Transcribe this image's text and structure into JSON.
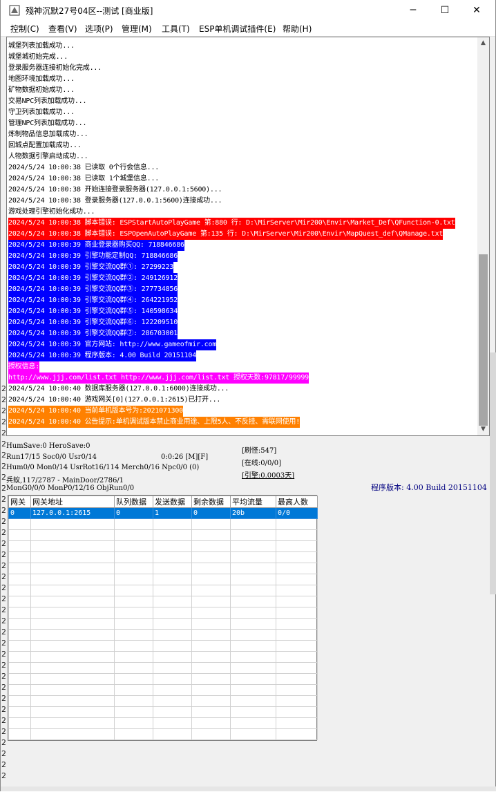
{
  "window": {
    "title": "殘神沉默27号04区--测试 [商业版]",
    "minimize_glyph": "─",
    "maximize_glyph": "☐",
    "close_glyph": "✕"
  },
  "menu": [
    "控制(C)",
    "查看(V)",
    "选项(P)",
    "管理(M)",
    "工具(T)",
    "ESP单机调试插件(E)",
    "帮助(H)"
  ],
  "log": [
    {
      "text": "城堡列表加载成功...",
      "bg": "",
      "fg": "#000000"
    },
    {
      "text": "城堡城初始完成...",
      "bg": "",
      "fg": "#000000"
    },
    {
      "text": "登录服务器连接初始化完成...",
      "bg": "",
      "fg": "#000000"
    },
    {
      "text": "地图环境加载成功...",
      "bg": "",
      "fg": "#000000"
    },
    {
      "text": "矿物数据初始成功...",
      "bg": "",
      "fg": "#000000"
    },
    {
      "text": "交易NPC列表加载成功...",
      "bg": "",
      "fg": "#000000"
    },
    {
      "text": "守卫列表加载成功...",
      "bg": "",
      "fg": "#000000"
    },
    {
      "text": "管理NPC列表加载成功...",
      "bg": "",
      "fg": "#000000"
    },
    {
      "text": "炼制物品信息加载成功...",
      "bg": "",
      "fg": "#000000"
    },
    {
      "text": "回城点配置加载成功...",
      "bg": "",
      "fg": "#000000"
    },
    {
      "text": "人物数据引擎启动成功...",
      "bg": "",
      "fg": "#000000"
    },
    {
      "text": "2024/5/24 10:00:38 已读取 0个行会信息...",
      "bg": "",
      "fg": "#000000"
    },
    {
      "text": "2024/5/24 10:00:38 已读取 1个城堡信息...",
      "bg": "",
      "fg": "#000000"
    },
    {
      "text": "2024/5/24 10:00:38 开始连接登录服务器(127.0.0.1:5600)...",
      "bg": "",
      "fg": "#000000"
    },
    {
      "text": "2024/5/24 10:00:38 登录服务器(127.0.0.1:5600)连接成功...",
      "bg": "",
      "fg": "#000000"
    },
    {
      "text": "游戏处理引擎初始化成功...",
      "bg": "",
      "fg": "#000000"
    },
    {
      "text": "2024/5/24 10:00:38 脚本错误: ESPStartAutoPlayGame 第:880 行: D:\\MirServer\\Mir200\\Envir\\Market_Def\\QFunction-0.txt",
      "bg": "#ff0000",
      "fg": "#ffffff"
    },
    {
      "text": "2024/5/24 10:00:38 脚本错误: ESPOpenAutoPlayGame 第:135 行: D:\\MirServer\\Mir200\\Envir\\MapQuest_def\\QManage.txt",
      "bg": "#ff0000",
      "fg": "#ffffff"
    },
    {
      "text": "2024/5/24 10:00:39 商业登录器购买QQ: 718846686",
      "bg": "#0000ff",
      "fg": "#ffffff"
    },
    {
      "text": "2024/5/24 10:00:39 引擎功能定制QQ: 718846686",
      "bg": "#0000ff",
      "fg": "#ffffff"
    },
    {
      "text": "2024/5/24 10:00:39 引擎交流QQ群①: 27299223",
      "bg": "#0000ff",
      "fg": "#ffffff"
    },
    {
      "text": "2024/5/24 10:00:39 引擎交流QQ群②: 249126912",
      "bg": "#0000ff",
      "fg": "#ffffff"
    },
    {
      "text": "2024/5/24 10:00:39 引擎交流QQ群③: 277734856",
      "bg": "#0000ff",
      "fg": "#ffffff"
    },
    {
      "text": "2024/5/24 10:00:39 引擎交流QQ群④: 264221952",
      "bg": "#0000ff",
      "fg": "#ffffff"
    },
    {
      "text": "2024/5/24 10:00:39 引擎交流QQ群⑤: 140598634",
      "bg": "#0000ff",
      "fg": "#ffffff"
    },
    {
      "text": "2024/5/24 10:00:39 引擎交流QQ群⑥: 122209510",
      "bg": "#0000ff",
      "fg": "#ffffff"
    },
    {
      "text": "2024/5/24 10:00:39 引擎交流QQ群⑦: 286703001",
      "bg": "#0000ff",
      "fg": "#ffffff"
    },
    {
      "text": "2024/5/24 10:00:39 官方网站: http://www.gameofmir.com",
      "bg": "#0000ff",
      "fg": "#ffffff"
    },
    {
      "text": "2024/5/24 10:00:39 程序版本: 4.00 Build 20151104",
      "bg": "#0000ff",
      "fg": "#ffffff"
    },
    {
      "text": "授权信息:",
      "bg": "#ff00ff",
      "fg": "#ffffff"
    },
    {
      "text": "http://www.jjj.com/list.txt http://www.jjj.com/list.txt 授权天数:97817/99999",
      "bg": "#ff00ff",
      "fg": "#ffffff"
    },
    {
      "text": "2024/5/24 10:00:40 数据库服务器(127.0.0.1:6000)连接成功...",
      "bg": "",
      "fg": "#000000"
    },
    {
      "text": "2024/5/24 10:00:40 游戏网关[0](127.0.0.1:2615)已打开...",
      "bg": "",
      "fg": "#000000"
    },
    {
      "text": "2024/5/24 10:00:40 当前单机版本号为:2021071300",
      "bg": "#ff8000",
      "fg": "#ffffff"
    },
    {
      "text": "2024/5/24 10:00:40 公告提示:单机调试版本禁止商业用途、上限5人、不反挂、需联网使用!",
      "bg": "#ff8000",
      "fg": "#ffffff"
    }
  ],
  "status": {
    "line1": "HumSave:0 HeroSave:0",
    "line2_a": "Run17/15 Soc0/0 Usr0/14",
    "line2_b": "0:0:26 [M][F]",
    "line3": "Hum0/0 Mon0/14 UsrRot16/114 Merch0/16 Npc0/0 (0)",
    "line4": "兵蚁,117/2787 - MainDoor/2786/1",
    "line5": "MonG0/0/0 MonP0/12/16 ObjRun0/0",
    "refresh": "[刷怪:547]",
    "online": "[在线:0/0/0]",
    "engine": "[引擎:0.0003天]",
    "version": "程序版本: 4.00 Build 20151104"
  },
  "gateway_table": {
    "columns": [
      "网关",
      "网关地址",
      "队列数据",
      "发送数据",
      "剩余数据",
      "平均流量",
      "最高人数"
    ],
    "rows": [
      [
        "0",
        "127.0.0.1:2615",
        "0",
        "1",
        "0",
        "20b",
        "0/0"
      ]
    ],
    "empty_rows": 20
  },
  "left_strip_digits": [
    "2",
    "2",
    "2",
    "2",
    "2",
    "2",
    "2",
    "2",
    "2",
    "2",
    "2",
    "2",
    "2",
    "2",
    "2",
    "2",
    "2",
    "2",
    "2",
    "2",
    "2",
    "2",
    "2",
    "2",
    "2",
    "2",
    "2",
    "2",
    "2",
    "2",
    "2",
    "2",
    "2",
    "2",
    "2",
    "2"
  ]
}
